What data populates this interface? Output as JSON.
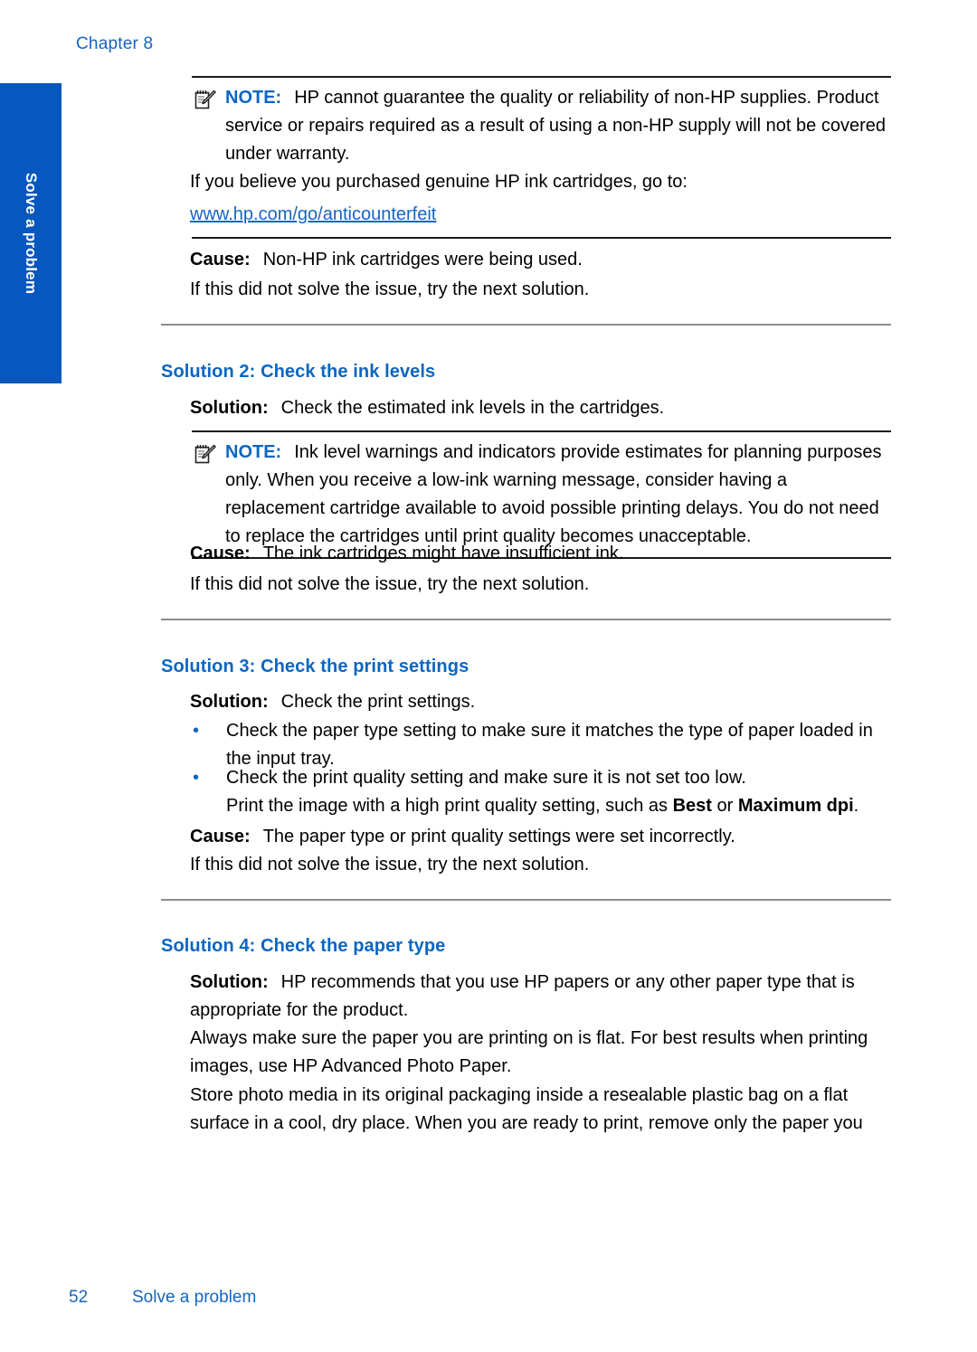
{
  "page": {
    "chapter_label": "Chapter 8",
    "side_tab_label": "Solve a problem",
    "footer_page_number": "52",
    "footer_section": "Solve a problem",
    "accent_heading_color": "#0A66C2",
    "accent_link_color": "#1565C0",
    "side_tab_color": "#0757BE",
    "rule_color": "#1a1a1a",
    "divider_color": "#8d8d8d"
  },
  "note_top": {
    "icon": "note-pad-pencil-icon",
    "keyword": "NOTE:",
    "text": "HP cannot guarantee the quality or reliability of non-HP supplies. Product service or repairs required as a result of using a non-HP supply will not be covered under warranty.",
    "followup": "If you believe you purchased genuine HP ink cartridges, go to:",
    "link_text": "www.hp.com/go/anticounterfeit"
  },
  "cause_top": {
    "label": "Cause:",
    "text": "Non-HP ink cartridges were being used.",
    "next": "If this did not solve the issue, try the next solution."
  },
  "solution2": {
    "heading": "Solution 2: Check the ink levels",
    "solution_label": "Solution:",
    "solution_text": "Check the estimated ink levels in the cartridges.",
    "note": {
      "icon": "note-pad-pencil-icon",
      "keyword": "NOTE:",
      "text": "Ink level warnings and indicators provide estimates for planning purposes only. When you receive a low-ink warning message, consider having a replacement cartridge available to avoid possible printing delays. You do not need to replace the cartridges until print quality becomes unacceptable."
    },
    "cause_label": "Cause:",
    "cause_text": "The ink cartridges might have insufficient ink.",
    "next": "If this did not solve the issue, try the next solution."
  },
  "solution3": {
    "heading": "Solution 3: Check the print settings",
    "solution_label": "Solution:",
    "solution_text": "Check the print settings.",
    "bullets": [
      "Check the paper type setting to make sure it matches the type of paper loaded in the input tray.",
      "Check the print quality setting and make sure it is not set too low."
    ],
    "bullet2_sub_pre": "Print the image with a high print quality setting, such as ",
    "bullet2_sub_bold1": "Best",
    "bullet2_sub_mid": " or ",
    "bullet2_sub_bold2": "Maximum dpi",
    "bullet2_sub_post": ".",
    "cause_label": "Cause:",
    "cause_text": "The paper type or print quality settings were set incorrectly.",
    "next": "If this did not solve the issue, try the next solution."
  },
  "solution4": {
    "heading": "Solution 4: Check the paper type",
    "solution_label": "Solution:",
    "solution_text": "HP recommends that you use HP papers or any other paper type that is appropriate for the product.",
    "paragraph2": "Always make sure the paper you are printing on is flat. For best results when printing images, use HP Advanced Photo Paper.",
    "paragraph3": "Store photo media in its original packaging inside a resealable plastic bag on a flat surface in a cool, dry place. When you are ready to print, remove only the paper you"
  }
}
